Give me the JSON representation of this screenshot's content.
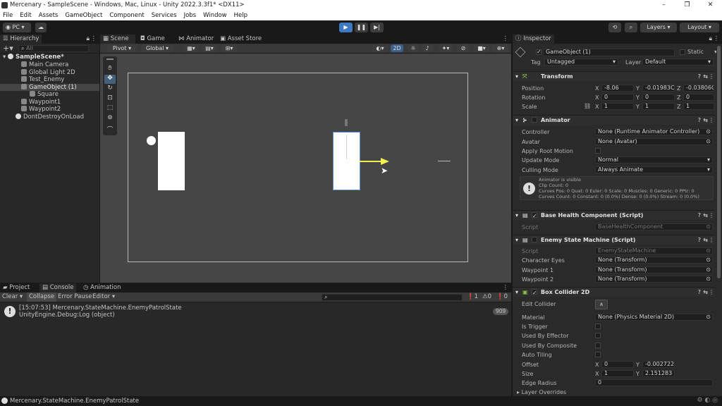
{
  "window": {
    "title": "Mercenary - SampleScene - Windows, Mac, Linux - Unity 2022.3.3f1* <DX11>",
    "controls": [
      "–",
      "❐",
      "✕"
    ]
  },
  "menu": [
    "File",
    "Edit",
    "Assets",
    "GameObject",
    "Component",
    "Services",
    "Jobs",
    "Window",
    "Help"
  ],
  "toolbar": {
    "platform": "PC",
    "layers": "Layers",
    "layout": "Layout"
  },
  "hierarchy": {
    "tab": "Hierarchy",
    "search_placeholder": "All",
    "items": [
      "SampleScene*",
      "Main Camera",
      "Global Light 2D",
      "Test_Enemy",
      "GameObject (1)",
      "Square",
      "Waypoint1",
      "Waypoint2",
      "DontDestroyOnLoad"
    ]
  },
  "scene": {
    "tabs": [
      "Scene",
      "Game",
      "Animator",
      "Asset Store"
    ],
    "pivot": "Pivot",
    "global": "Global",
    "mode2d": "2D"
  },
  "console": {
    "tabs": [
      "Project",
      "Console",
      "Animation"
    ],
    "buttons": [
      "Clear",
      "Collapse",
      "Error Pause",
      "Editor"
    ],
    "counts": [
      "1",
      "0",
      "0"
    ],
    "log_line1": "[15:07:53] Mercenary.StateMachine.EnemyPatrolState",
    "log_line2": "UnityEngine.Debug:Log (object)",
    "log_count": "909"
  },
  "statusbar": {
    "text": "Mercenary.StateMachine.EnemyPatrolState"
  },
  "inspector": {
    "tab": "Inspector",
    "object_name": "GameObject (1)",
    "static": "Static",
    "tag_label": "Tag",
    "tag": "Untagged",
    "layer_label": "Layer",
    "layer": "Default",
    "transform": {
      "title": "Transform",
      "position_label": "Position",
      "position": [
        "-8.06",
        "-0.01983C",
        "-0.03806C"
      ],
      "rotation_label": "Rotation",
      "rotation": [
        "0",
        "0",
        "0"
      ],
      "scale_label": "Scale",
      "scale": [
        "1",
        "1",
        "1"
      ]
    },
    "animator": {
      "title": "Animator",
      "controller_label": "Controller",
      "controller": "None (Runtime Animator Controller)",
      "avatar_label": "Avatar",
      "avatar": "None (Avatar)",
      "root_motion_label": "Apply Root Motion",
      "update_mode_label": "Update Mode",
      "update_mode": "Normal",
      "culling_label": "Culling Mode",
      "culling": "Always Animate",
      "info1": "Animator is visible",
      "info2": "Clip Count: 0",
      "info3": "Curves Pos: 0 Quat: 0 Euler: 0 Scale: 0 Muscles: 0 Generic: 0 PPtr: 0",
      "info4": "Curves Count: 0 Constant: 0 (0.0%) Dense: 0 (0.0%) Stream: 0 (0.0%)"
    },
    "base_health": {
      "title": "Base Health Component (Script)",
      "script_label": "Script",
      "script": "BaseHealthComponent"
    },
    "state_machine": {
      "title": "Enemy State Machine (Script)",
      "script_label": "Script",
      "script": "EnemyStateMachine",
      "eyes_label": "Character Eyes",
      "eyes": "None (Transform)",
      "wp1_label": "Waypoint 1",
      "wp1": "None (Transform)",
      "wp2_label": "Waypoint 2",
      "wp2": "None (Transform)"
    },
    "box_collider": {
      "title": "Box Collider 2D",
      "edit_label": "Edit Collider",
      "material_label": "Material",
      "material": "None (Physics Material 2D)",
      "trigger_label": "Is Trigger",
      "effector_label": "Used By Effector",
      "composite_label": "Used By Composite",
      "tiling_label": "Auto Tiling",
      "offset_label": "Offset",
      "offset": [
        "0",
        "-0.002722"
      ],
      "size_label": "Size",
      "size": [
        "1",
        "2.151283"
      ],
      "radius_label": "Edge Radius",
      "radius": "0",
      "overrides_label": "Layer Overrides"
    }
  }
}
